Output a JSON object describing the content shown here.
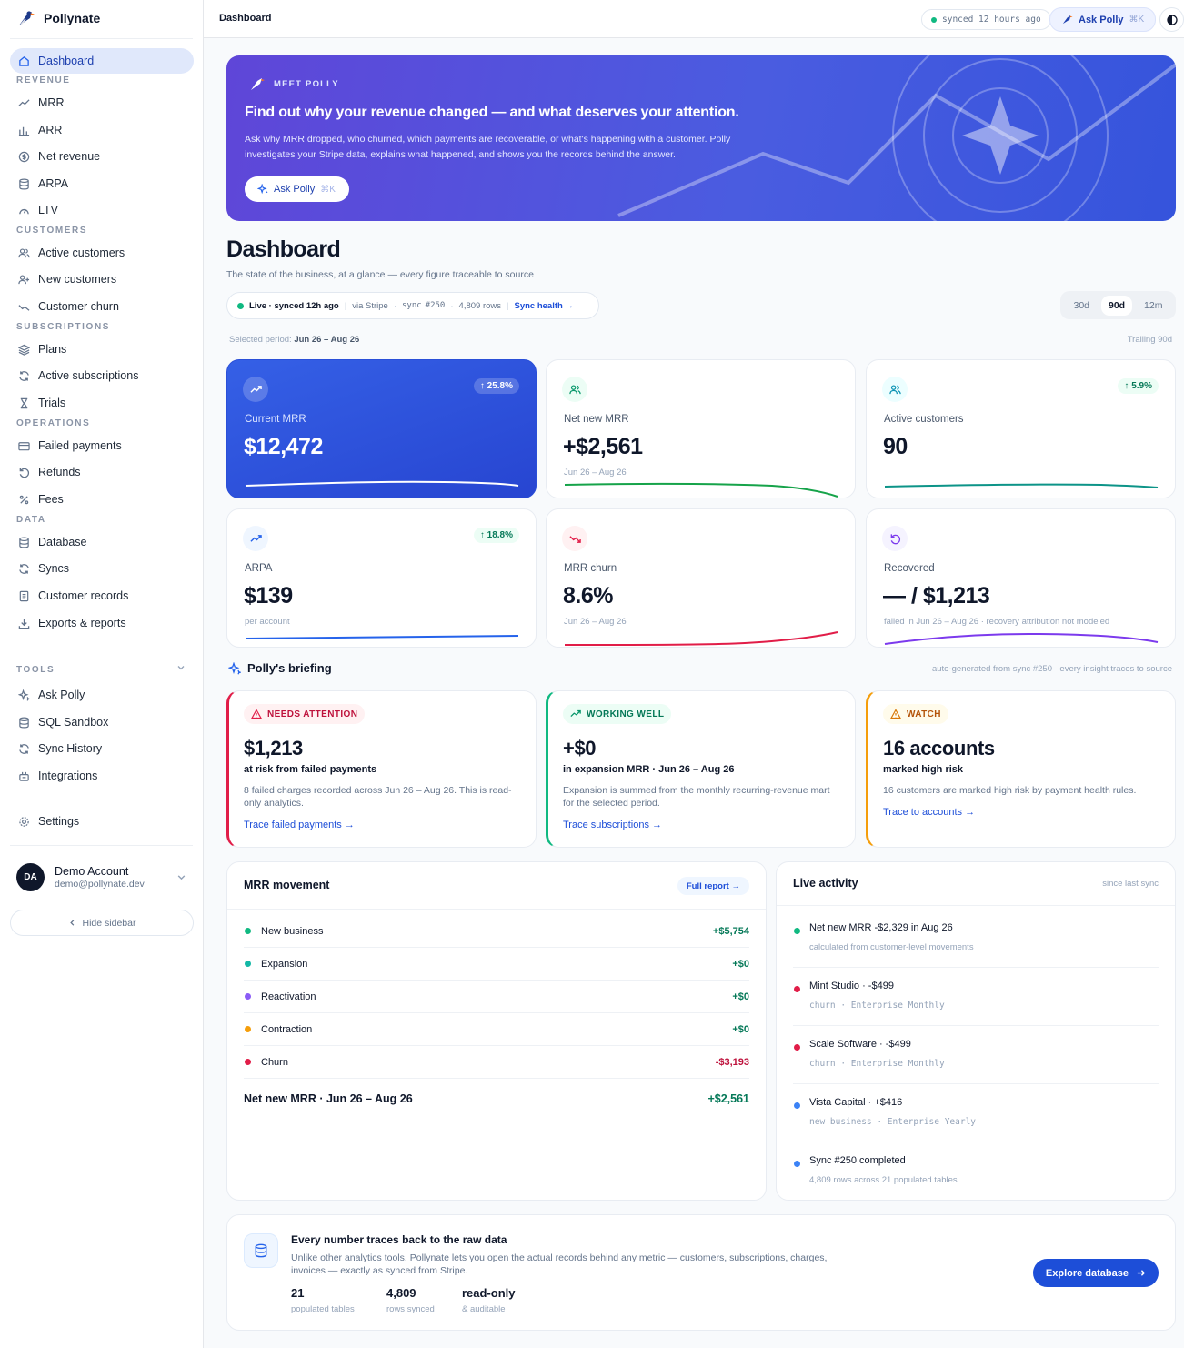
{
  "brand": {
    "name": "Pollynate"
  },
  "sidebar": {
    "sections": {
      "revenue": "REVENUE",
      "customers": "CUSTOMERS",
      "subscriptions": "SUBSCRIPTIONS",
      "operations": "OPERATIONS",
      "data": "DATA",
      "tools": "TOOLS"
    },
    "items": {
      "dashboard": "Dashboard",
      "mrr": "MRR",
      "arr": "ARR",
      "net_revenue": "Net revenue",
      "arpa": "ARPA",
      "ltv": "LTV",
      "active_customers": "Active customers",
      "new_customers": "New customers",
      "customer_churn": "Customer churn",
      "plans": "Plans",
      "active_subscriptions": "Active subscriptions",
      "trials": "Trials",
      "failed_payments": "Failed payments",
      "refunds": "Refunds",
      "fees": "Fees",
      "database": "Database",
      "syncs": "Syncs",
      "customer_records": "Customer records",
      "exports_reports": "Exports & reports",
      "ask_polly": "Ask Polly",
      "sql_sandbox": "SQL Sandbox",
      "sync_history": "Sync History",
      "integrations": "Integrations",
      "settings": "Settings"
    },
    "account": {
      "initials": "DA",
      "name": "Demo Account",
      "email": "demo@pollynate.dev"
    },
    "hide_label": "Hide sidebar"
  },
  "topbar": {
    "title": "Dashboard",
    "sync_status": "synced 12 hours ago",
    "ask_label": "Ask Polly",
    "shortcut": "⌘K"
  },
  "hero": {
    "eyebrow": "MEET POLLY",
    "title": "Find out why your revenue changed — and what deserves your attention.",
    "body": "Ask why MRR dropped, who churned, which payments are recoverable, or what's happening with a customer. Polly investigates your Stripe data, explains what happened, and shows you the records behind the answer.",
    "button": "Ask Polly",
    "shortcut": "⌘K"
  },
  "page": {
    "title": "Dashboard",
    "subtitle": "The state of the business, at a glance — every figure traceable to source"
  },
  "status": {
    "live": "Live · synced 12h ago",
    "source": "via Stripe",
    "sync_prefix": "sync",
    "sync_id": "#250",
    "rows": "4,809 rows",
    "health": "Sync health →"
  },
  "ranges": {
    "options": [
      "30d",
      "90d",
      "12m"
    ],
    "selected": "90d"
  },
  "period": {
    "label": "Selected period:",
    "value": "Jun 26 – Aug 26",
    "trailing": "Trailing 90d"
  },
  "kpis": [
    {
      "label": "Current MRR",
      "value": "$12,472",
      "badge": "↑ 25.8%",
      "sub": ""
    },
    {
      "label": "Net new MRR",
      "value": "+$2,561",
      "badge": "",
      "sub": "Jun 26 – Aug 26"
    },
    {
      "label": "Active customers",
      "value": "90",
      "badge": "↑ 5.9%",
      "sub": ""
    },
    {
      "label": "ARPA",
      "value": "$139",
      "badge": "↑ 18.8%",
      "sub": "per account"
    },
    {
      "label": "MRR churn",
      "value": "8.6%",
      "badge": "",
      "sub": "Jun 26 – Aug 26"
    },
    {
      "label": "Recovered",
      "value": "— / $1,213",
      "badge": "",
      "sub": "failed in Jun 26 – Aug 26 · recovery attribution not modeled"
    }
  ],
  "briefing": {
    "title": "Polly's briefing",
    "note": "auto-generated from sync #250 · every insight traces to source",
    "cards": [
      {
        "tag": "NEEDS ATTENTION",
        "big": "$1,213",
        "sub": "at risk from failed payments",
        "desc": "8 failed charges recorded across Jun 26 – Aug 26. This is read-only analytics.",
        "link": "Trace failed payments →"
      },
      {
        "tag": "WORKING WELL",
        "big": "+$0",
        "sub": "in expansion MRR · Jun 26 – Aug 26",
        "desc": "Expansion is summed from the monthly recurring-revenue mart for the selected period.",
        "link": "Trace subscriptions →"
      },
      {
        "tag": "WATCH",
        "big": "16 accounts",
        "sub": "marked high risk",
        "desc": "16 customers are marked high risk by payment health rules.",
        "link": "Trace to accounts →"
      }
    ]
  },
  "movement": {
    "title": "MRR movement",
    "button": "Full report →",
    "rows": [
      {
        "label": "New business",
        "amount": "+$5,754",
        "color": "#10b981"
      },
      {
        "label": "Expansion",
        "amount": "+$0",
        "color": "#14b8a6"
      },
      {
        "label": "Reactivation",
        "amount": "+$0",
        "color": "#8b5cf6"
      },
      {
        "label": "Contraction",
        "amount": "+$0",
        "color": "#f59e0b"
      },
      {
        "label": "Churn",
        "amount": "-$3,193",
        "color": "#e11d48"
      }
    ],
    "total_label": "Net new MRR · Jun 26 – Aug 26",
    "total": "+$2,561"
  },
  "activity": {
    "title": "Live activity",
    "note": "since last sync",
    "items": [
      {
        "title": "Net new MRR -$2,329 in Aug 26",
        "sub": "calculated from customer-level movements",
        "color": "#10b981"
      },
      {
        "title": "Mint Studio · -$499",
        "sub": "churn · Enterprise Monthly",
        "color": "#e11d48"
      },
      {
        "title": "Scale Software · -$499",
        "sub": "churn · Enterprise Monthly",
        "color": "#e11d48"
      },
      {
        "title": "Vista Capital · +$416",
        "sub": "new business · Enterprise Yearly",
        "color": "#3b82f6"
      },
      {
        "title": "Sync #250 completed",
        "sub": "4,809 rows across 21 populated tables",
        "color": "#3b82f6"
      }
    ]
  },
  "footer": {
    "title": "Every number traces back to the raw data",
    "body": "Unlike other analytics tools, Pollynate lets you open the actual records behind any metric — customers, subscriptions, charges, invoices — exactly as synced from Stripe.",
    "stats": [
      {
        "value": "21",
        "label": "populated tables"
      },
      {
        "value": "4,809",
        "label": "rows synced"
      },
      {
        "value": "read-only",
        "label": "& auditable"
      }
    ],
    "button": "Explore database"
  }
}
